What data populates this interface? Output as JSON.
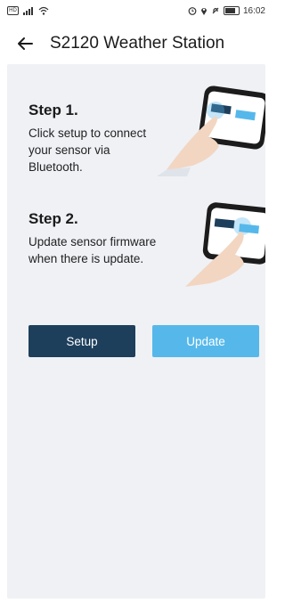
{
  "status": {
    "left_icons": [
      "sim-icon",
      "signal-icon",
      "wifi-icon"
    ],
    "right_icons": [
      "alarm-icon",
      "location-icon",
      "mute-icon",
      "battery-icon"
    ],
    "battery": "80",
    "time": "16:02"
  },
  "header": {
    "title": "S2120 Weather Station",
    "back_icon": "arrow-left-icon"
  },
  "steps": [
    {
      "title": "Step 1.",
      "text": "Click setup to connect your sensor via Bluetooth."
    },
    {
      "title": "Step 2.",
      "text": "Update sensor firmware when there is update."
    }
  ],
  "illustration": {
    "setup_label": "Setup",
    "update_label": "Update"
  },
  "buttons": {
    "setup": "Setup",
    "update": "Update"
  },
  "colors": {
    "card_bg": "#eff1f5",
    "setup_bg": "#1e3f5c",
    "update_bg": "#56b8ea"
  }
}
